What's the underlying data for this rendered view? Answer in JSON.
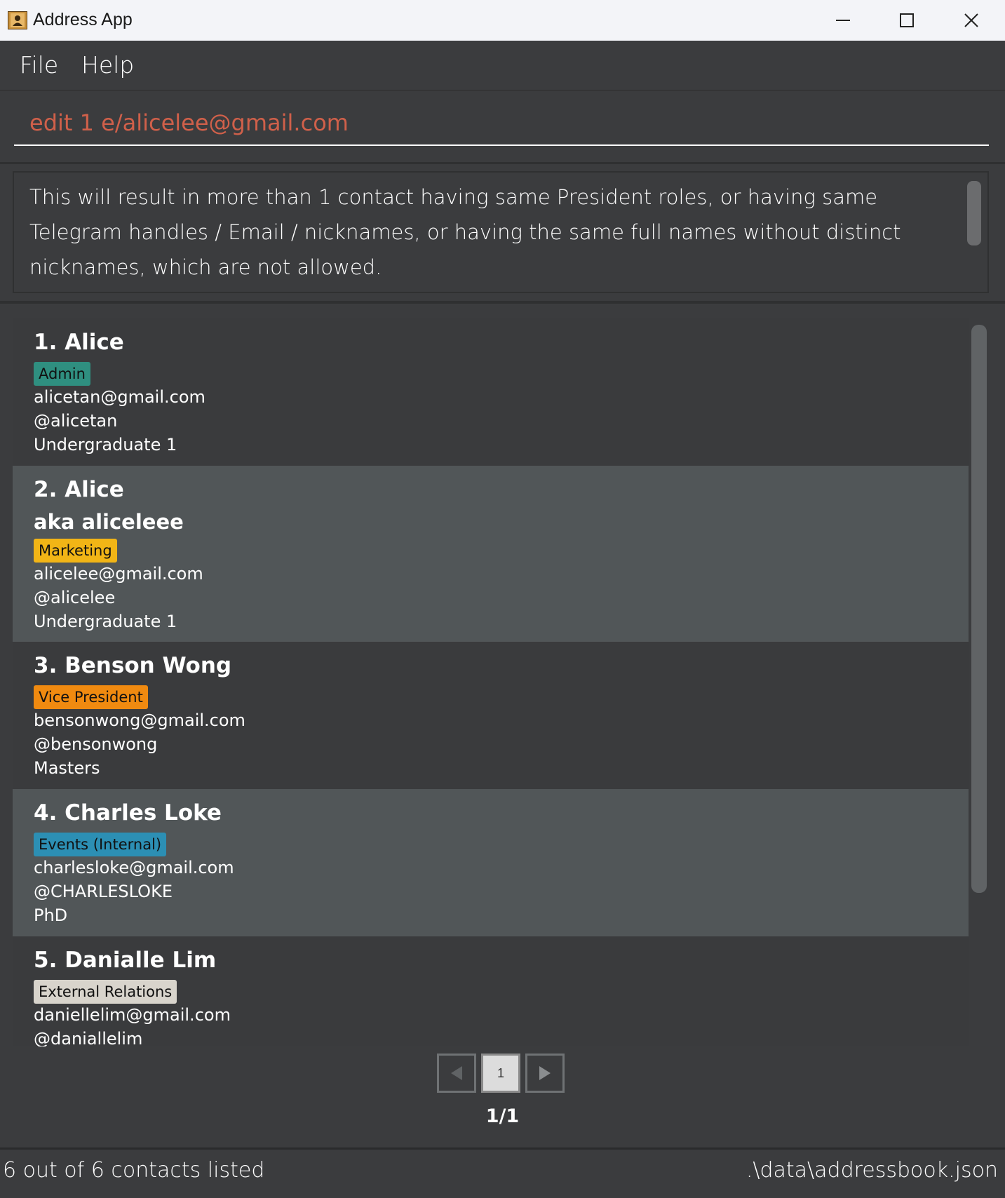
{
  "window": {
    "title": "Address App"
  },
  "menu": {
    "file": "File",
    "help": "Help"
  },
  "command": {
    "value": "edit 1 e/alicelee@gmail.com",
    "placeholder": ""
  },
  "result": {
    "message": "This will result in more than 1 contact having same President roles, or having same Telegram handles / Email / nicknames, or having the same full names without distinct nicknames, which are not allowed."
  },
  "persons": [
    {
      "name": "1. Alice",
      "nickname": "",
      "tag": "Admin",
      "tag_color": "#2f8f80",
      "email": "alicetan@gmail.com",
      "telegram": "@alicetan",
      "level": "Undergraduate 1"
    },
    {
      "name": "2. Alice",
      "nickname": "aka aliceleee",
      "tag": "Marketing",
      "tag_color": "#f2b516",
      "email": "alicelee@gmail.com",
      "telegram": "@alicelee",
      "level": "Undergraduate 1"
    },
    {
      "name": "3. Benson Wong",
      "nickname": "",
      "tag": "Vice President",
      "tag_color": "#f08a10",
      "email": "bensonwong@gmail.com",
      "telegram": "@bensonwong",
      "level": "Masters"
    },
    {
      "name": "4. Charles Loke",
      "nickname": "",
      "tag": "Events (Internal)",
      "tag_color": "#2c8fb4",
      "email": "charlesloke@gmail.com",
      "telegram": "@CHARLESLOKE",
      "level": "PhD"
    },
    {
      "name": "5. Danialle Lim",
      "nickname": "",
      "tag": "External Relations",
      "tag_color": "#d8d4cc",
      "email": "daniellelim@gmail.com",
      "telegram": "@daniallelim",
      "level": ""
    }
  ],
  "pagination": {
    "current_page": "1",
    "label": "1/1"
  },
  "status": {
    "summary": "6 out of 6 contacts listed",
    "path": ".\\data\\addressbook.json"
  }
}
